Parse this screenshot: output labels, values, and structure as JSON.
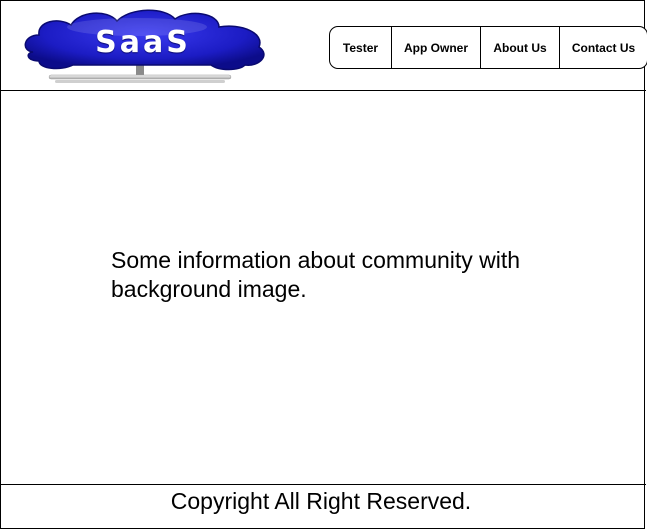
{
  "header": {
    "logo_text": "SaaS",
    "nav": [
      {
        "label": "Tester"
      },
      {
        "label": "App Owner"
      },
      {
        "label": "About Us"
      },
      {
        "label": "Contact Us"
      }
    ]
  },
  "main": {
    "info_line1": "Some information about community with",
    "info_line2": "background image."
  },
  "footer": {
    "copyright": "Copyright All Right Reserved."
  },
  "colors": {
    "cloud_blue": "#1c1cc4",
    "cloud_dark": "#0c0c8a",
    "border": "#000000",
    "background": "#ffffff"
  }
}
